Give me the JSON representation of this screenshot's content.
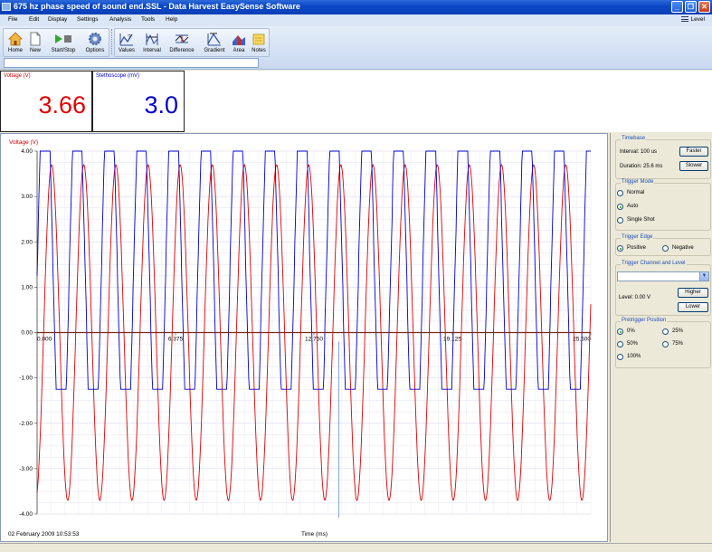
{
  "window": {
    "title": "675 hz phase speed of sound end.SSL - Data Harvest EasySense Software",
    "minimize_glyph": "_",
    "maximize_glyph": "❐",
    "close_glyph": "✕"
  },
  "menu": {
    "items": [
      "File",
      "Edit",
      "Display",
      "Settings",
      "Analysis",
      "Tools",
      "Help"
    ],
    "level_label": "Level"
  },
  "toolbar": {
    "home": "Home",
    "new": "New",
    "start_stop": "Start/Stop",
    "options": "Options",
    "values": "Values",
    "interval": "Interval",
    "difference": "Difference",
    "gradient": "Gradient",
    "area": "Area",
    "notes": "Notes"
  },
  "meters": [
    {
      "label": "Voltage (V)",
      "value": "3.66",
      "color": "#e00000"
    },
    {
      "label": "Stethoscope (mV)",
      "value": "3.0",
      "color": "#0000cc"
    }
  ],
  "graph": {
    "y_label": "Voltage (V)",
    "x_label": "Time (ms)",
    "timestamp": "02 February 2009  10:53:53",
    "y_ticks": [
      "4.00",
      "3.00",
      "2.00",
      "1.00",
      "0.00",
      "-1.00",
      "-2.00",
      "-3.00",
      "-4.00"
    ],
    "x_ticks": [
      "0.000",
      "6.375",
      "12.750",
      "19.125",
      "25.500"
    ]
  },
  "chart_data": {
    "type": "line",
    "ylabel": "Voltage (V)",
    "xlabel": "Time (ms)",
    "xlim": [
      0,
      25.5
    ],
    "ylim": [
      -4,
      4
    ],
    "x_ticks": [
      0,
      6.375,
      12.75,
      19.125,
      25.5
    ],
    "y_ticks": [
      4,
      3,
      2,
      1,
      0,
      -1,
      -2,
      -3,
      -4
    ],
    "grid": true,
    "series": [
      {
        "color": "#e00000",
        "shape": "sine",
        "period_ms": 1.48,
        "amplitude": 3.7,
        "phase_ms": 0.3
      },
      {
        "color": "#0000cc",
        "shape": "clipped",
        "period_ms": 1.48,
        "max": 4.0,
        "min": -1.35,
        "phase_ms": 0.0
      }
    ],
    "cursor_x": 13.9
  },
  "side": {
    "timebase_title": "Timebase",
    "interval": "Interval: 100 us",
    "duration": "Duration: 25.6 ms",
    "faster": "Faster",
    "slower": "Slower",
    "trigger_mode_title": "Trigger Mode",
    "mode_normal": "Normal",
    "mode_auto": "Auto",
    "mode_single": "Single Shot",
    "trigger_edge_title": "Trigger Edge",
    "edge_positive": "Positive",
    "edge_negative": "Negative",
    "trigger_channel_title": "Trigger Channel and Level",
    "level": "Level: 0.00 V",
    "higher": "Higher",
    "lower": "Lower",
    "pretrigger_title": "Pretrigger Position",
    "pre_0": "0%",
    "pre_25": "25%",
    "pre_50": "50%",
    "pre_75": "75%",
    "pre_100": "100%"
  }
}
